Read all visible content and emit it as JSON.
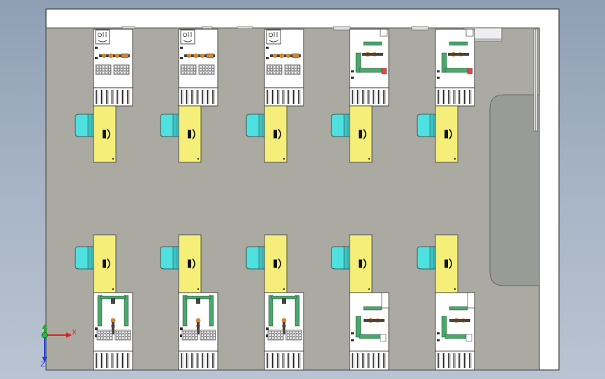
{
  "viewport": {
    "background_top": "#8f9fb4",
    "background_bottom": "#b9c4d2"
  },
  "room": {
    "frame_color": "#ffffff",
    "floor_color": "#abaaa2",
    "side_area_color": "#999b96"
  },
  "workstations": {
    "desk_color": "#f5ef7a",
    "chair_color": "#4fe0e0",
    "cabinet_color": "#ffffff",
    "robot_arm_color": "#49a86c",
    "robot_joint_color": "#d7862a",
    "tray_color": "#444444",
    "top_row": [
      "panel",
      "panel",
      "panel",
      "arm",
      "arm"
    ],
    "bottom_row": [
      "gantry",
      "gantry",
      "gantry",
      "arm",
      "arm"
    ]
  },
  "triad": {
    "x_label": "X",
    "z_label": "Z",
    "x_color": "#e02020",
    "y_color": "#20b020",
    "z_color": "#2040e0"
  }
}
